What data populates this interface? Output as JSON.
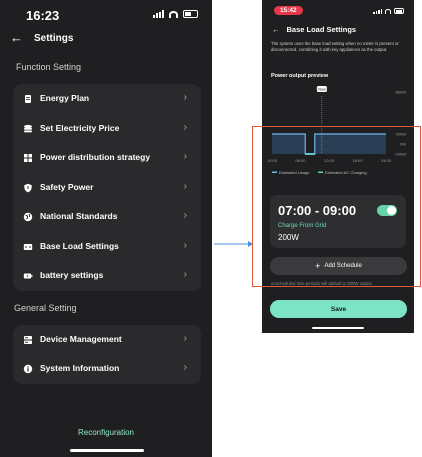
{
  "left_screen": {
    "status_time": "16:23",
    "header": {
      "back_icon": "back-arrow-icon",
      "title": "Settings"
    },
    "function_section_label": "Function Setting",
    "function_items": [
      {
        "label": "Energy Plan",
        "icon": "energy-plan-icon"
      },
      {
        "label": "Set Electricity Price",
        "icon": "database-coins-icon"
      },
      {
        "label": "Power distribution strategy",
        "icon": "distribution-grid-icon"
      },
      {
        "label": "Safety Power",
        "icon": "shield-icon"
      },
      {
        "label": "National Standards",
        "icon": "globe-icon"
      },
      {
        "label": "Base Load Settings",
        "icon": "base-load-icon"
      },
      {
        "label": "battery settings",
        "icon": "battery-icon"
      }
    ],
    "general_section_label": "General Setting",
    "general_items": [
      {
        "label": "Device Management",
        "icon": "device-icon"
      },
      {
        "label": "System Information",
        "icon": "info-icon"
      }
    ],
    "reconfiguration_label": "Reconfiguration"
  },
  "right_screen": {
    "status_time": "15:42",
    "title": "Base Load Settings",
    "description": "The system uses the base load setting when no meter is present or disconnected, combining it with key appliances as the output.",
    "preview_label": "Power output preview",
    "now_label": "Now",
    "legend": [
      "Estimated Usage",
      "Estimated AC Charging"
    ],
    "schedule": {
      "time_range": "07:00 - 09:00",
      "mode": "Charge From Grid",
      "power": "200W",
      "enabled": true
    },
    "add_schedule_label": "Add Schedule",
    "note_text": "unscheduled time periods will default to 200W output.",
    "save_label": "Save"
  },
  "colors": {
    "accent": "#7ce3c4",
    "background": "#1f1f21",
    "card": "#2a2a2d",
    "usage_line": "#6ab7e8",
    "ac_charging": "#67d3a8",
    "highlight_box": "#e0573a",
    "recording_pill": "#e8364a"
  },
  "chart_data": {
    "type": "line",
    "x": [
      "00:00",
      "06:00",
      "12:00",
      "18:00",
      "24:00"
    ],
    "y_tick_labels": [
      "800W",
      "200W",
      "0W",
      "-200W"
    ],
    "series": [
      {
        "name": "Estimated Usage",
        "points": [
          [
            "00:00",
            200
          ],
          [
            "07:00",
            200
          ],
          [
            "07:00",
            -200
          ],
          [
            "09:00",
            -200
          ],
          [
            "09:00",
            200
          ],
          [
            "24:00",
            200
          ]
        ]
      },
      {
        "name": "Estimated AC Charging",
        "points": [
          [
            "07:00",
            -200
          ],
          [
            "09:00",
            -200
          ]
        ]
      }
    ]
  }
}
